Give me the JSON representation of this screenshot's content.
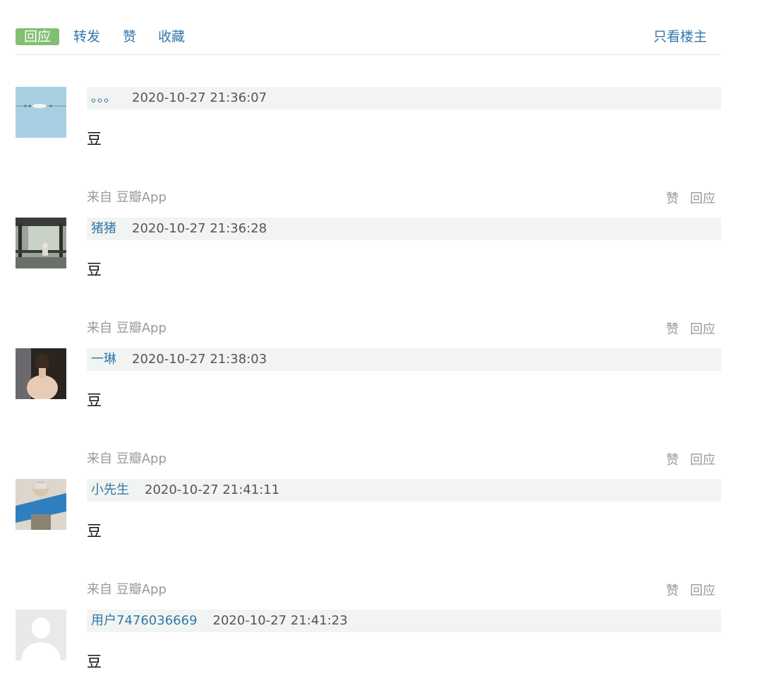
{
  "toolbar": {
    "reply_label": "回应",
    "repost_label": "转发",
    "like_label": "赞",
    "favorite_label": "收藏",
    "only_op_label": "只看楼主"
  },
  "colors": {
    "link": "#3377aa",
    "reply_bg": "#83bf73",
    "meta_bg": "#f1f4f1",
    "muted": "#999999"
  },
  "comments": [
    {
      "author": "。。。",
      "time": "2020-10-27 21:36:07",
      "body": "豆",
      "source": "来自 豆瓣App",
      "like": "赞",
      "reply": "回应",
      "avatar_icon": "sky-photo-avatar"
    },
    {
      "author": "猪猪",
      "time": "2020-10-27 21:36:28",
      "body": "豆",
      "source": "来自 豆瓣App",
      "like": "赞",
      "reply": "回应",
      "avatar_icon": "pavilion-photo-avatar"
    },
    {
      "author": "一琳",
      "time": "2020-10-27 21:38:03",
      "body": "豆",
      "source": "来自 豆瓣App",
      "like": "赞",
      "reply": "回应",
      "avatar_icon": "portrait-photo-avatar"
    },
    {
      "author": "小先生",
      "time": "2020-10-27 21:41:11",
      "body": "豆",
      "source": "来自 豆瓣App",
      "like": "赞",
      "reply": "回应",
      "avatar_icon": "banner-photo-avatar"
    },
    {
      "author": "用户7476036669",
      "time": "2020-10-27 21:41:23",
      "body": "豆",
      "avatar_icon": "default-user-avatar"
    }
  ]
}
